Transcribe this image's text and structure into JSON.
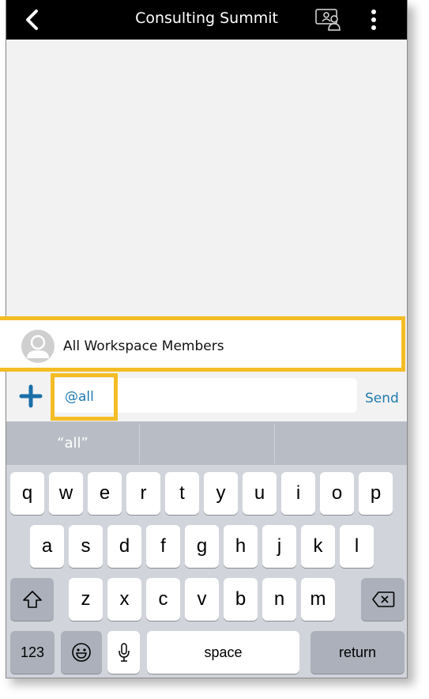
{
  "navbar": {
    "title": "Consulting Summit",
    "back_icon": "chevron-left-icon",
    "people_icon": "channel-members-icon",
    "more_icon": "more-vertical-icon"
  },
  "mention_suggestion": {
    "label": "All Workspace Members",
    "avatar_icon": "default-avatar-icon"
  },
  "composer": {
    "add_icon": "plus-icon",
    "input_value": "@all",
    "send_label": "Send"
  },
  "predictive": [
    "“all”",
    "",
    ""
  ],
  "keyboard": {
    "row1": [
      "q",
      "w",
      "e",
      "r",
      "t",
      "y",
      "u",
      "i",
      "o",
      "p"
    ],
    "row2": [
      "a",
      "s",
      "d",
      "f",
      "g",
      "h",
      "j",
      "k",
      "l"
    ],
    "row3": [
      "z",
      "x",
      "c",
      "v",
      "b",
      "n",
      "m"
    ],
    "numbers_label": "123",
    "space_label": "space",
    "return_label": "return",
    "shift_icon": "shift-icon",
    "backspace_icon": "backspace-icon",
    "emoji_icon": "emoji-icon",
    "mic_icon": "microphone-icon"
  },
  "colors": {
    "highlight": "#f4bd25",
    "accent": "#1f7bb0",
    "navbar": "#000000"
  }
}
